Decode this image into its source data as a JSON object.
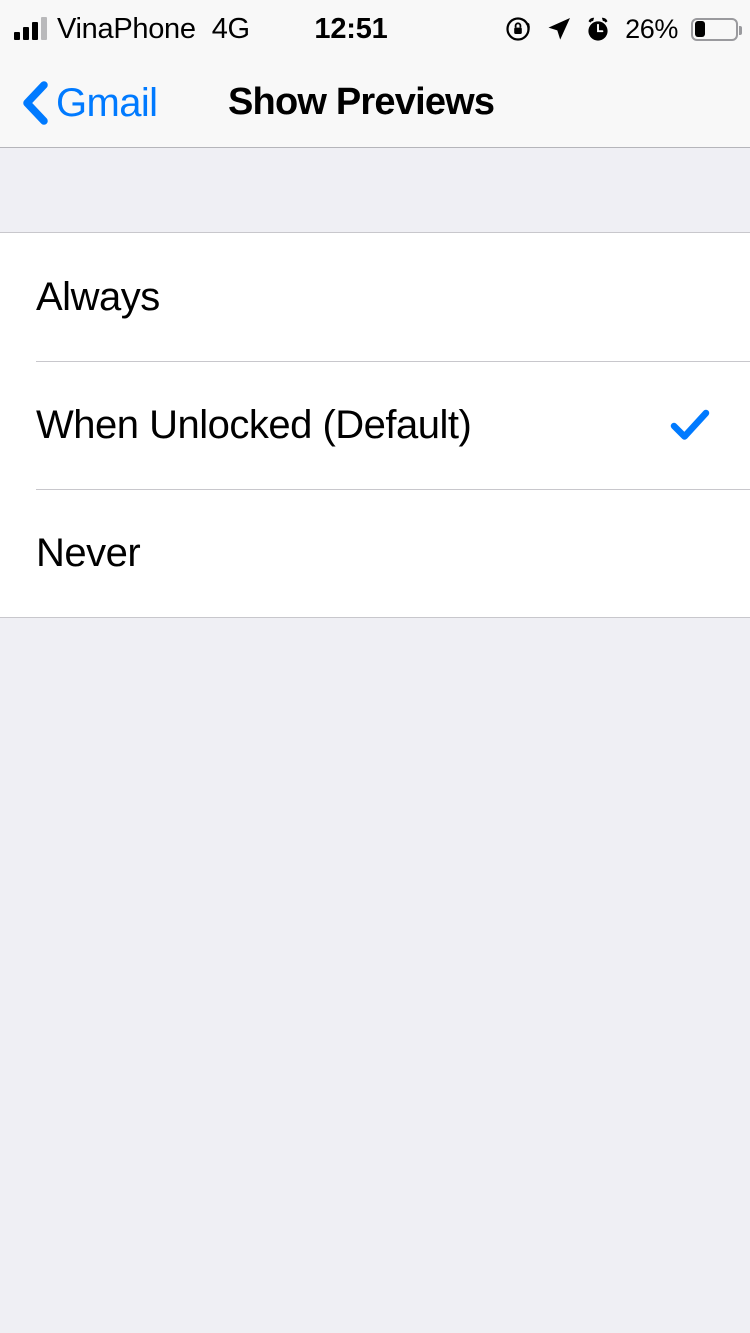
{
  "status_bar": {
    "carrier": "VinaPhone",
    "network_type": "4G",
    "time": "12:51",
    "battery_percent_label": "26%",
    "battery_level": 26,
    "icons": {
      "signal": "signal-bars-icon",
      "rotation_lock": "rotation-lock-icon",
      "location": "location-arrow-icon",
      "alarm": "alarm-clock-icon",
      "battery": "battery-icon"
    }
  },
  "nav_bar": {
    "back_label": "Gmail",
    "title": "Show Previews"
  },
  "list": {
    "options": [
      {
        "label": "Always",
        "selected": false
      },
      {
        "label": "When Unlocked (Default)",
        "selected": true
      },
      {
        "label": "Never",
        "selected": false
      }
    ]
  },
  "colors": {
    "accent": "#007AFF",
    "nav_background": "#F8F8F8",
    "group_background": "#EFEFF4",
    "row_background": "#FFFFFF",
    "separator": "#C8C7CC",
    "text": "#000000"
  }
}
